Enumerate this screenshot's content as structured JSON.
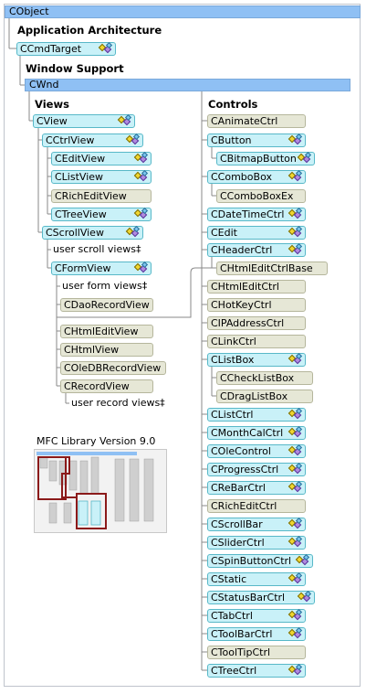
{
  "top_class": {
    "label": "CObject"
  },
  "headings": {
    "app_arch": "Application Architecture",
    "window_support": "Window Support",
    "views": "Views",
    "controls": "Controls"
  },
  "cmdtarget": {
    "label": "CCmdTarget"
  },
  "wnd": {
    "label": "CWnd"
  },
  "views": {
    "cview": "CView",
    "cctrlview": "CCtrlView",
    "ctrl_children": [
      "CEditView",
      "CListView",
      "CRichEditView",
      "CTreeView"
    ],
    "cscrollview": "CScrollView",
    "user_scroll_views": "user scroll views‡",
    "cformview": "CFormView",
    "user_form_views": "user form views‡",
    "cdaorecordview": "CDaoRecordView",
    "form_children": [
      "CHtmlEditView",
      "CHtmlView",
      "COleDBRecordView",
      "CRecordView"
    ],
    "user_record_views": "user record views‡"
  },
  "controls": {
    "items": [
      "CAnimateCtrl",
      "CButton",
      "CBitmapButton",
      "CComboBox",
      "CComboBoxEx",
      "CDateTimeCtrl",
      "CEdit",
      "CHeaderCtrl",
      "CHtmlEditCtrlBase",
      "CHtmlEditCtrl",
      "CHotKeyCtrl",
      "CIPAddressCtrl",
      "CLinkCtrl",
      "CListBox",
      "CCheckListBox",
      "CDragListBox",
      "CListCtrl",
      "CMonthCalCtrl",
      "COleControl",
      "CProgressCtrl",
      "CReBarCtrl",
      "CRichEditCtrl",
      "CScrollBar",
      "CSliderCtrl",
      "CSpinButtonCtrl",
      "CStatic",
      "CStatusBarCtrl",
      "CTabCtrl",
      "CToolBarCtrl",
      "CToolTipCtrl",
      "CTreeCtrl"
    ]
  },
  "minimap": {
    "title": "MFC Library Version 9.0"
  },
  "colors": {
    "band": "#8fc0f4",
    "node_blue": "#c9f1f8",
    "node_beige": "#e6e7d6",
    "connector": "#8a8a8a",
    "highlight": "#8b1a1a"
  }
}
